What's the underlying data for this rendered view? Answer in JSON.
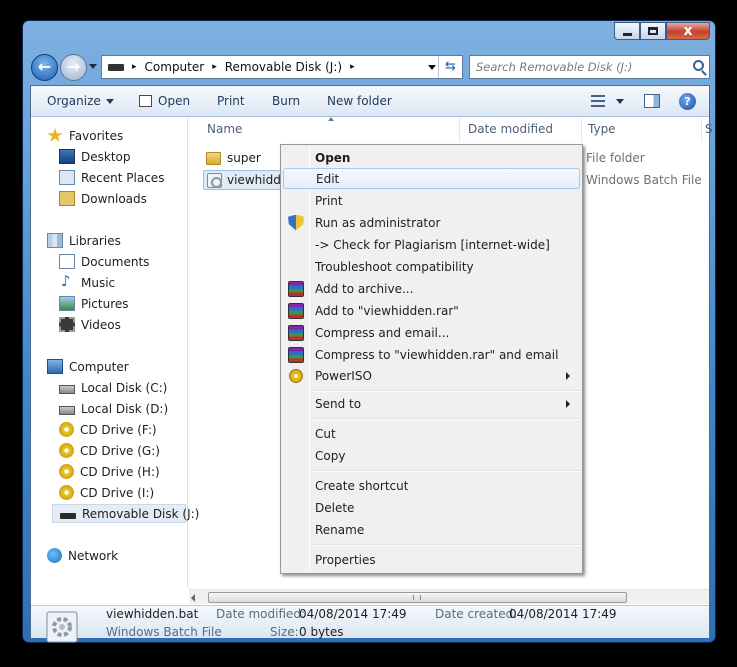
{
  "window": {
    "controls": {
      "minimize": "minimize",
      "maximize": "maximize",
      "close": "x"
    }
  },
  "navigation": {
    "back_glyph": "←",
    "forward_glyph": "→",
    "address": {
      "crumbs": [
        "Computer",
        "Removable Disk (J:)"
      ],
      "separator": "▸",
      "refresh_glyph": "⇆"
    },
    "search": {
      "placeholder": "Search Removable Disk (J:)"
    }
  },
  "toolbar": {
    "organize": "Organize",
    "open": "Open",
    "print": "Print",
    "burn": "Burn",
    "new_folder": "New folder",
    "help_glyph": "?"
  },
  "sidebar": {
    "favorites": {
      "label": "Favorites",
      "items": [
        "Desktop",
        "Recent Places",
        "Downloads"
      ]
    },
    "libraries": {
      "label": "Libraries",
      "items": [
        "Documents",
        "Music",
        "Pictures",
        "Videos"
      ]
    },
    "computer": {
      "label": "Computer",
      "items": [
        "Local Disk (C:)",
        "Local Disk (D:)",
        "CD Drive (F:)",
        "CD Drive (G:)",
        "CD Drive (H:)",
        "CD Drive (I:)",
        "Removable Disk (J:)"
      ],
      "selected": "Removable Disk (J:)"
    },
    "network": {
      "label": "Network"
    }
  },
  "file_list": {
    "columns": [
      "Name",
      "Date modified",
      "Type",
      "S"
    ],
    "rows": [
      {
        "name": "super",
        "type": "File folder",
        "icon": "folder-icon"
      },
      {
        "name": "viewhidde",
        "type": "Windows Batch File",
        "icon": "batch-file-icon",
        "selected": true
      }
    ]
  },
  "details_pane": {
    "file_name": "viewhidden.bat",
    "file_type": "Windows Batch File",
    "date_modified_label": "Date modified:",
    "date_modified": "04/08/2014 17:49",
    "date_created_label": "Date created:",
    "date_created": "04/08/2014 17:49",
    "size_label": "Size:",
    "size": "0 bytes"
  },
  "context_menu": {
    "items": [
      {
        "label": "Open",
        "bold": true
      },
      {
        "label": "Edit",
        "highlighted": true
      },
      {
        "label": "Print"
      },
      {
        "label": "Run as administrator",
        "icon": "uac-shield-icon"
      },
      {
        "label": "-> Check for Plagiarism [internet-wide]"
      },
      {
        "label": "Troubleshoot compatibility"
      },
      {
        "label": "Add to archive...",
        "icon": "winrar-icon"
      },
      {
        "label": "Add to \"viewhidden.rar\"",
        "icon": "winrar-icon"
      },
      {
        "label": "Compress and email...",
        "icon": "winrar-icon"
      },
      {
        "label": "Compress to \"viewhidden.rar\" and email",
        "icon": "winrar-icon"
      },
      {
        "label": "PowerISO",
        "icon": "poweriso-icon",
        "submenu": true
      },
      {
        "label": "Send to",
        "submenu": true
      },
      {
        "label": "Cut"
      },
      {
        "label": "Copy"
      },
      {
        "label": "Create shortcut"
      },
      {
        "label": "Delete"
      },
      {
        "label": "Rename"
      },
      {
        "label": "Properties"
      }
    ]
  },
  "colors": {
    "frame": "#3e86c9",
    "selection": "#dfeaf7",
    "menu_highlight": "#e3eefa",
    "toolbar_text": "#1e395b"
  }
}
